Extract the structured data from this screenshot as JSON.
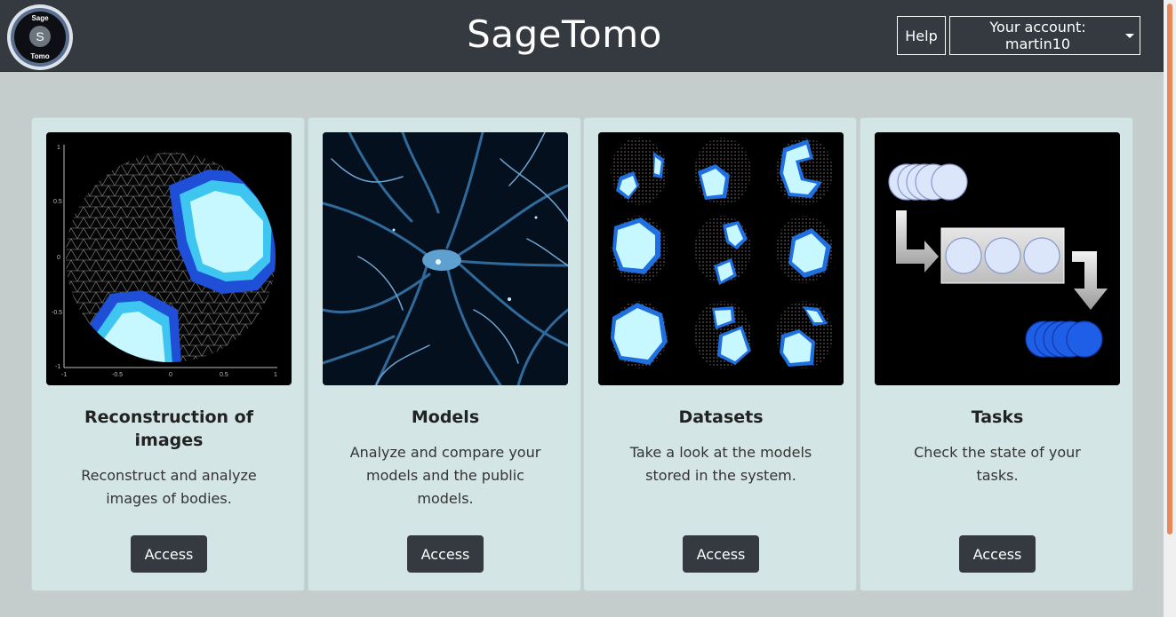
{
  "brand": {
    "title": "SageTomo",
    "logo_top": "Sage",
    "logo_mid": "S",
    "logo_bottom": "Tomo"
  },
  "nav": {
    "help_label": "Help",
    "account_label": "Your account: martin10"
  },
  "cards": [
    {
      "title": "Reconstruction of images",
      "description": "Reconstruct and analyze images of bodies.",
      "button": "Access",
      "axis_ticks": {
        "y": [
          "1",
          "0.5",
          "0",
          "-0.5",
          "-1"
        ],
        "x": [
          "-1",
          "-0.5",
          "0",
          "0.5",
          "1"
        ]
      }
    },
    {
      "title": "Models",
      "description": "Analyze and compare your models and the public models.",
      "button": "Access"
    },
    {
      "title": "Datasets",
      "description": "Take a look at the models stored in the system.",
      "button": "Access"
    },
    {
      "title": "Tasks",
      "description": "Check the state of your tasks.",
      "button": "Access"
    }
  ],
  "colors": {
    "navbar": "#343a40",
    "background": "#c5cccc",
    "card": "#d4e5e5",
    "accent_blue": "#1f6fe0",
    "light_cyan": "#c8f8ff"
  }
}
